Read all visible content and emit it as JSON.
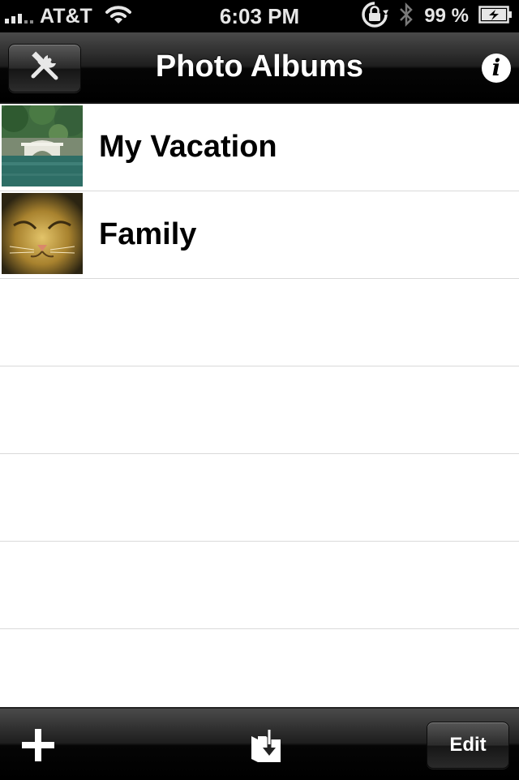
{
  "status_bar": {
    "carrier": "AT&T",
    "time": "6:03 PM",
    "battery_percent": "99 %",
    "icons": [
      "signal-icon",
      "wifi-icon",
      "rotation-lock-icon",
      "bluetooth-icon",
      "battery-charging-icon"
    ]
  },
  "nav_bar": {
    "title": "Photo Albums",
    "left_button_icon": "tools-icon",
    "right_button_icon": "info-icon",
    "info_glyph": "i"
  },
  "albums": [
    {
      "name": "My Vacation",
      "thumbnail": "bridge-lake-photo"
    },
    {
      "name": "Family",
      "thumbnail": "cat-face-photo"
    }
  ],
  "toolbar": {
    "add_icon": "plus-icon",
    "import_icon": "folder-import-icon",
    "edit_label": "Edit"
  },
  "colors": {
    "bar_background": "#000000",
    "list_background": "#ffffff",
    "separator": "#d9d9d9"
  }
}
